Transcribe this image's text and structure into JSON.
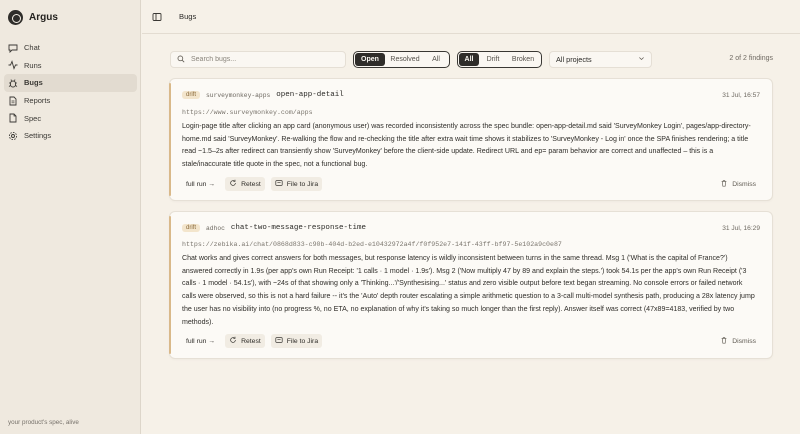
{
  "app": {
    "name": "Argus",
    "tagline": "your product's spec, alive"
  },
  "sidebar": {
    "items": [
      {
        "label": "Chat",
        "icon": "chat-icon"
      },
      {
        "label": "Runs",
        "icon": "activity-icon"
      },
      {
        "label": "Bugs",
        "icon": "bug-icon",
        "active": true
      },
      {
        "label": "Reports",
        "icon": "report-icon"
      },
      {
        "label": "Spec",
        "icon": "file-icon"
      },
      {
        "label": "Settings",
        "icon": "gear-icon"
      }
    ]
  },
  "header": {
    "title": "Bugs"
  },
  "filters": {
    "search_placeholder": "Search bugs...",
    "status": [
      "Open",
      "Resolved",
      "All"
    ],
    "status_selected": "Open",
    "kind": [
      "All",
      "Drift",
      "Broken"
    ],
    "kind_selected": "All",
    "project": "All projects",
    "count": "2 of 2 findings"
  },
  "findings": [
    {
      "badge": "drift",
      "source": "surveymonkey-apps",
      "title": "open-app-detail",
      "date": "31 Jul, 16:57",
      "url": "https://www.surveymonkey.com/apps",
      "body": "Login-page title after clicking an app card (anonymous user) was recorded inconsistently across the spec bundle: open-app-detail.md said 'SurveyMonkey Login', pages/app-directory-home.md said 'SurveyMonkey'. Re-walking the flow and re-checking the title after extra wait time shows it stabilizes to 'SurveyMonkey - Log in' once the SPA finishes rendering; a title read ~1.5–2s after redirect can transiently show 'SurveyMonkey' before the client-side update. Redirect URL and ep= param behavior are correct and unaffected – this is a stale/inaccurate title quote in the spec, not a functional bug.",
      "actions": {
        "full_run": "full run →",
        "retest": "Retest",
        "jira": "File to Jira",
        "dismiss": "Dismiss"
      }
    },
    {
      "badge": "drift",
      "source": "adhoc",
      "title": "chat-two-message-response-time",
      "date": "31 Jul, 16:29",
      "url": "https://zebika.ai/chat/0868d833-c90b-404d-b2ed-e10432972a4f/f0f952e7-141f-43ff-bf97-5e102a9c0e87",
      "body": "Chat works and gives correct answers for both messages, but response latency is wildly inconsistent between turns in the same thread. Msg 1 ('What is the capital of France?') answered correctly in 1.9s (per app's own Run Receipt: '1 calls · 1 model · 1.9s'). Msg 2 ('Now multiply 47 by 89 and explain the steps.') took 54.1s per the app's own Run Receipt ('3 calls · 1 model · 54.1s'), with ~24s of that showing only a 'Thinking...'/'Synthesising...' status and zero visible output before text began streaming. No console errors or failed network calls were observed, so this is not a hard failure -- it's the 'Auto' depth router escalating a simple arithmetic question to a 3-call multi-model synthesis path, producing a 28x latency jump the user has no visibility into (no progress %, no ETA, no explanation of why it's taking so much longer than the first reply). Answer itself was correct (47x89=4183, verified by two methods).",
      "actions": {
        "full_run": "full run →",
        "retest": "Retest",
        "jira": "File to Jira",
        "dismiss": "Dismiss"
      }
    }
  ]
}
